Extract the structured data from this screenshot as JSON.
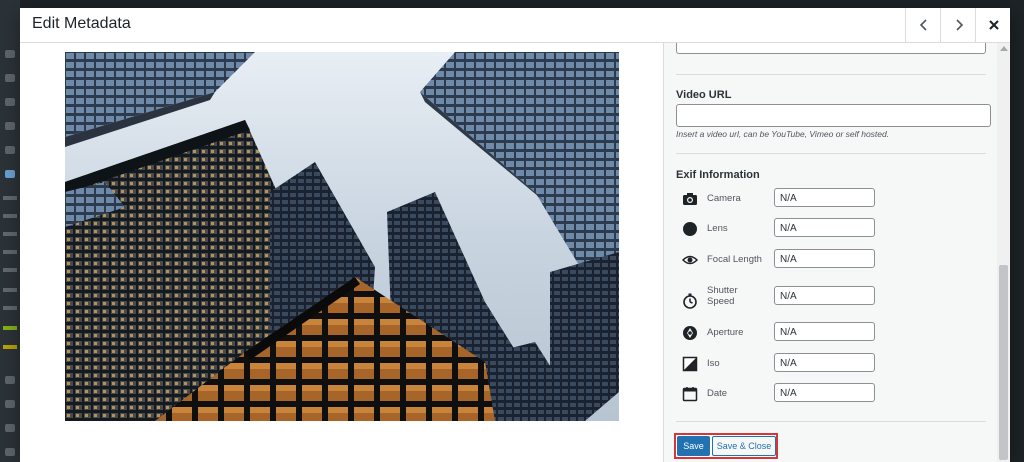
{
  "modal": {
    "title": "Edit Metadata"
  },
  "video": {
    "label": "Video URL",
    "value": "",
    "help": "Insert a video url, can be YouTube, Vimeo or self hosted."
  },
  "exif": {
    "heading": "Exif Information",
    "rows": [
      {
        "label": "Camera",
        "value": "N/A",
        "icon": "camera-icon"
      },
      {
        "label": "Lens",
        "value": "N/A",
        "icon": "lens-icon"
      },
      {
        "label": "Focal Length",
        "value": "N/A",
        "icon": "eye-icon"
      },
      {
        "label": "Shutter Speed",
        "value": "N/A",
        "icon": "stopwatch-icon"
      },
      {
        "label": "Aperture",
        "value": "N/A",
        "icon": "aperture-icon"
      },
      {
        "label": "Iso",
        "value": "N/A",
        "icon": "iso-icon"
      },
      {
        "label": "Date",
        "value": "N/A",
        "icon": "calendar-icon"
      }
    ]
  },
  "actions": {
    "save_label": "Save",
    "save_close_label": "Save & Close"
  },
  "colors": {
    "primary": "#2271b1",
    "highlight_border": "#d63638"
  }
}
